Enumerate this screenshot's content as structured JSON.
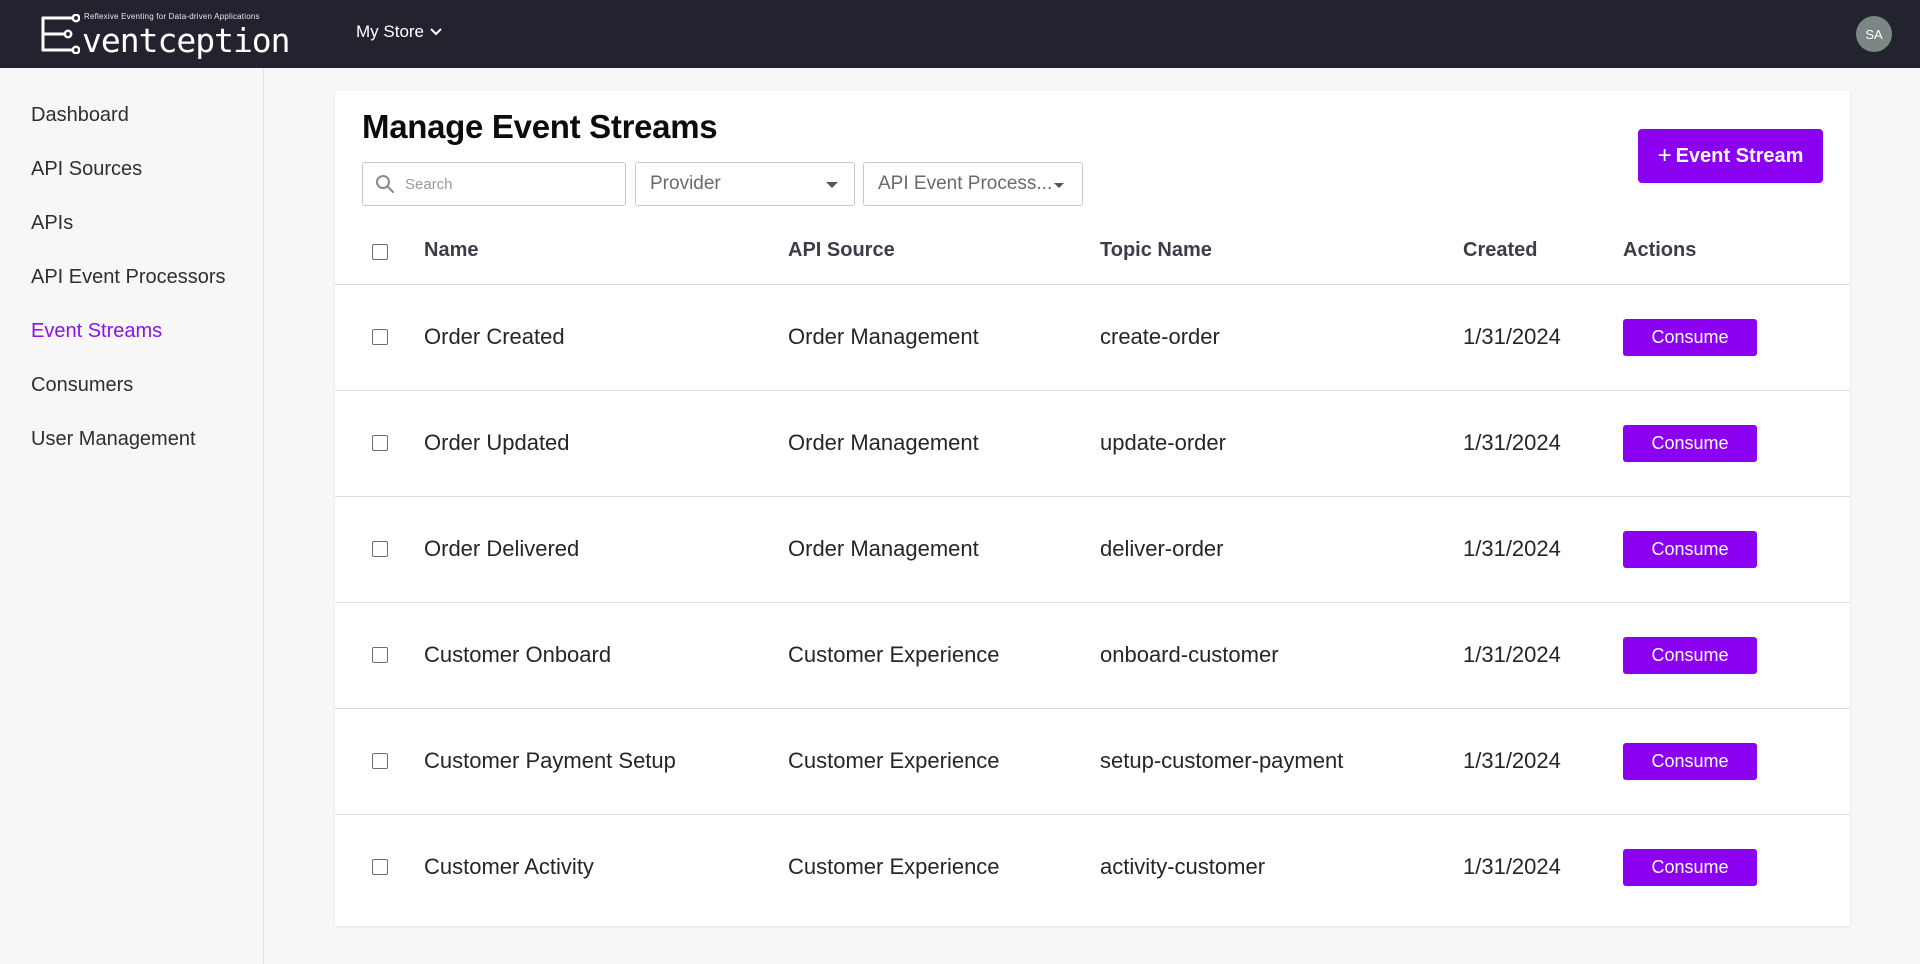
{
  "app": {
    "logo_tagline": "Reflexive Eventing for Data-driven Applications",
    "logo_word": "ventception",
    "store_menu_label": "My Store",
    "avatar_initials": "SA"
  },
  "sidebar": {
    "items": [
      {
        "label": "Dashboard",
        "active": false
      },
      {
        "label": "API Sources",
        "active": false
      },
      {
        "label": "APIs",
        "active": false
      },
      {
        "label": "API Event Processors",
        "active": false
      },
      {
        "label": "Event Streams",
        "active": true
      },
      {
        "label": "Consumers",
        "active": false
      },
      {
        "label": "User Management",
        "active": false
      }
    ]
  },
  "main": {
    "title": "Manage Event Streams",
    "add_button_plus": "+",
    "add_button_label": "Event Stream",
    "search_placeholder": "Search",
    "provider_filter": "Provider",
    "processor_filter": "API Event Process...",
    "columns": {
      "name": "Name",
      "api_source": "API Source",
      "topic_name": "Topic Name",
      "created": "Created",
      "actions": "Actions"
    },
    "rows": [
      {
        "name": "Order Created",
        "api_source": "Order Management",
        "topic_name": "create-order",
        "created": "1/31/2024",
        "action": "Consume"
      },
      {
        "name": "Order Updated",
        "api_source": "Order Management",
        "topic_name": "update-order",
        "created": "1/31/2024",
        "action": "Consume"
      },
      {
        "name": "Order Delivered",
        "api_source": "Order Management",
        "topic_name": "deliver-order",
        "created": "1/31/2024",
        "action": "Consume"
      },
      {
        "name": "Customer Onboard",
        "api_source": "Customer Experience",
        "topic_name": "onboard-customer",
        "created": "1/31/2024",
        "action": "Consume"
      },
      {
        "name": "Customer Payment Setup",
        "api_source": "Customer Experience",
        "topic_name": "setup-customer-payment",
        "created": "1/31/2024",
        "action": "Consume"
      },
      {
        "name": "Customer Activity",
        "api_source": "Customer Experience",
        "topic_name": "activity-customer",
        "created": "1/31/2024",
        "action": "Consume"
      }
    ]
  },
  "colors": {
    "topbar": "#22232e",
    "accent": "#8b00f0",
    "active_nav": "#8b12e8"
  }
}
